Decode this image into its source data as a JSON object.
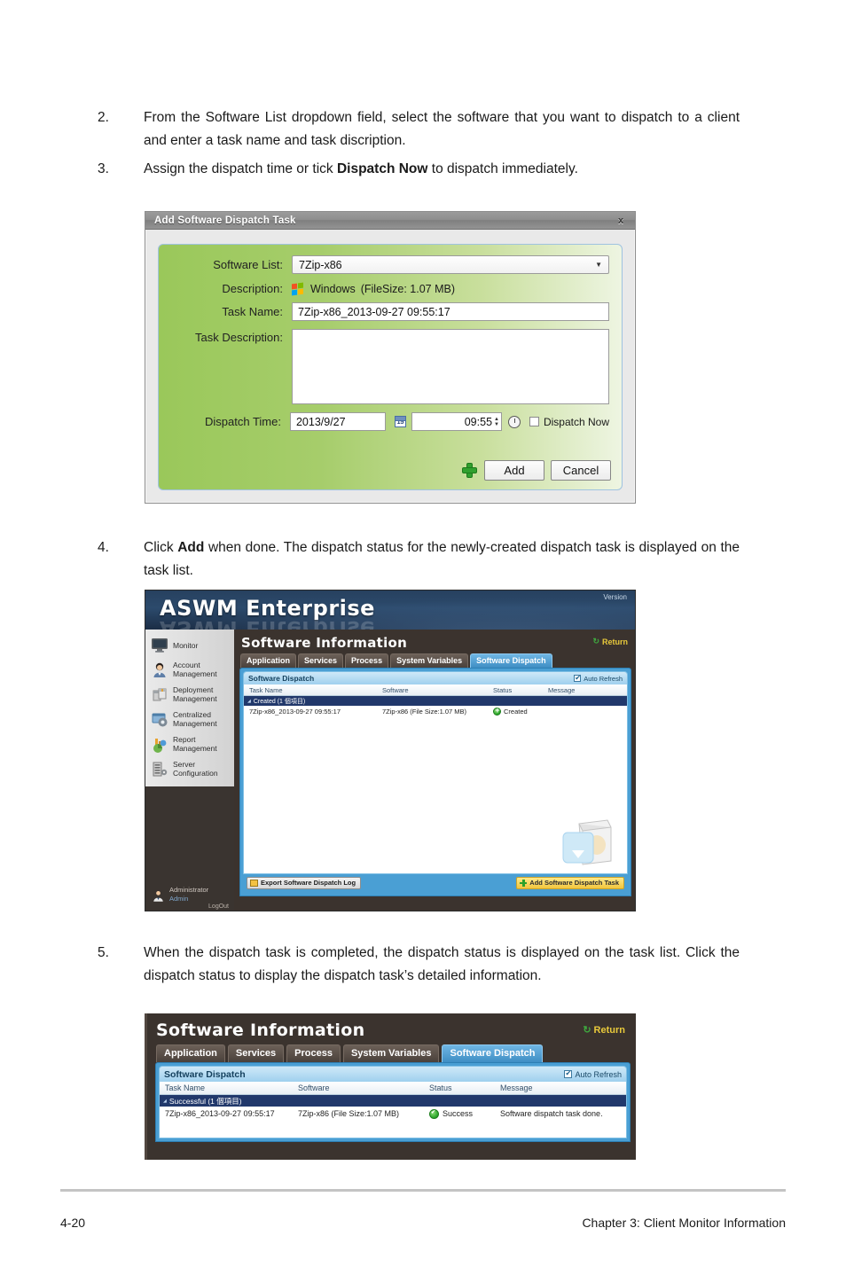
{
  "steps": [
    {
      "num": "2.",
      "html": "From the Software List dropdown field, select the software that you want to dispatch to a client and enter a task name and task discription."
    },
    {
      "num": "3.",
      "html": "Assign the dispatch time or tick <b>Dispatch Now</b> to dispatch immediately."
    },
    {
      "num": "4.",
      "html": "Click <b>Add</b> when done. The dispatch status for the newly-created dispatch task is displayed on the task list."
    },
    {
      "num": "5.",
      "html": "When the dispatch task is completed, the dispatch status is displayed on the task list. Click the dispatch status to display the dispatch task’s detailed information."
    }
  ],
  "dialog": {
    "title": "Add Software Dispatch Task",
    "close_label": "x",
    "labels": {
      "software_list": "Software List:",
      "description": "Description:",
      "task_name": "Task Name:",
      "task_description": "Task Description:",
      "dispatch_time": "Dispatch Time:"
    },
    "software_list_value": "7Zip-x86",
    "description_os": "Windows",
    "description_filesize": "(FileSize: 1.07 MB)",
    "task_name_value": "7Zip-x86_2013-09-27 09:55:17",
    "task_description_value": "",
    "date_value": "2013/9/27",
    "time_value": "09:55",
    "calendar_day": "15",
    "dispatch_now_label": "Dispatch Now",
    "add_label": "Add",
    "cancel_label": "Cancel"
  },
  "app": {
    "brand": "ASWM Enterprise",
    "version_label": "Version",
    "page_title": "Software Information",
    "return_label": "Return",
    "return_icon": "refresh-icon",
    "sidebar": [
      {
        "label": "Monitor",
        "icon": "monitor-icon"
      },
      {
        "label": "Account Management",
        "icon": "user-icon"
      },
      {
        "label": "Deployment Management",
        "icon": "boxes-icon"
      },
      {
        "label": "Centralized Management",
        "icon": "gear-window-icon"
      },
      {
        "label": "Report Management",
        "icon": "chart-icon"
      },
      {
        "label": "Server Configuration",
        "icon": "server-icon"
      }
    ],
    "admin": {
      "role": "Administrator",
      "name": "Admin",
      "logout": "LogOut"
    },
    "tabs": [
      {
        "label": "Application",
        "active": false
      },
      {
        "label": "Services",
        "active": false
      },
      {
        "label": "Process",
        "active": false
      },
      {
        "label": "System Variables",
        "active": false
      },
      {
        "label": "Software Dispatch",
        "active": true
      }
    ],
    "panel_title": "Software Dispatch",
    "auto_refresh_label": "Auto Refresh",
    "columns": [
      "Task Name",
      "Software",
      "Status",
      "Message"
    ],
    "export_button": "Export Software Dispatch Log",
    "add_button": "Add Software Dispatch Task"
  },
  "figure2": {
    "group_row": "Created (1 個項目)",
    "row": {
      "task_name": "7Zip-x86_2013-09-27 09:55:17",
      "software": "7Zip-x86  (File Size:1.07 MB)",
      "status": "Created",
      "message": ""
    }
  },
  "figure3": {
    "group_row": "Successful (1 個項目)",
    "row": {
      "task_name": "7Zip-x86_2013-09-27 09:55:17",
      "software": "7Zip-x86  (File Size:1.07 MB)",
      "status": "Success",
      "message": "Software dispatch task done."
    }
  },
  "footer": {
    "page_number": "4-20",
    "chapter": "Chapter 3: Client Monitor Information"
  }
}
